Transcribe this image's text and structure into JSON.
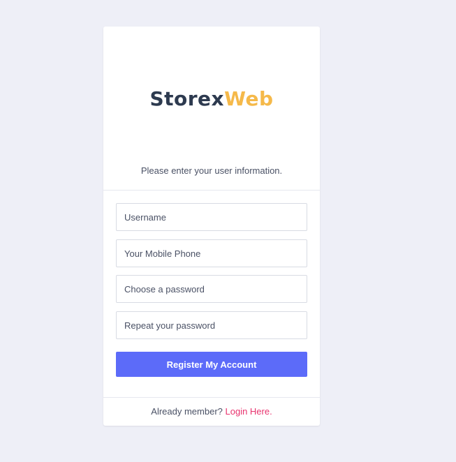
{
  "brand": {
    "part_a": "Storex",
    "part_b": "Web",
    "color_a": "#2d3a4f",
    "color_b": "#f5b94a"
  },
  "intro_text": "Please enter your user information.",
  "form": {
    "username_placeholder": "Username",
    "phone_placeholder": "Your Mobile Phone",
    "password_placeholder": "Choose a password",
    "repeat_password_placeholder": "Repeat your password",
    "submit_label": "Register My Account",
    "submit_color": "#5c6bf9"
  },
  "footer": {
    "prompt": "Already member? ",
    "link_label": "Login Here.",
    "link_color": "#e8336e"
  }
}
